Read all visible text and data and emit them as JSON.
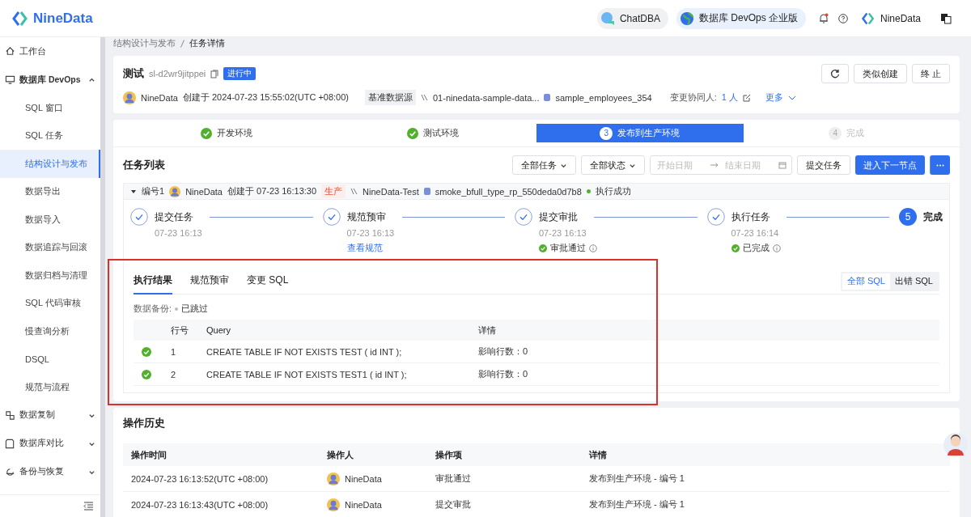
{
  "header": {
    "brand": "NineData",
    "chat_button": "ChatDBA",
    "edition_button": "数据库 DevOps 企业版",
    "user": "NineData"
  },
  "sidebar": {
    "items": [
      {
        "kind": "link",
        "label": "工作台",
        "selected": false
      },
      {
        "kind": "group",
        "label": "数据库 DevOps",
        "expanded": true,
        "children": [
          {
            "label": "SQL 窗口",
            "selected": false
          },
          {
            "label": "SQL 任务",
            "selected": false
          },
          {
            "label": "结构设计与发布",
            "selected": true
          },
          {
            "label": "数据导出",
            "selected": false
          },
          {
            "label": "数据导入",
            "selected": false
          },
          {
            "label": "数据追踪与回滚",
            "selected": false
          },
          {
            "label": "数据归档与清理",
            "selected": false
          },
          {
            "label": "SQL 代码审核",
            "selected": false
          },
          {
            "label": "慢查询分析",
            "selected": false
          },
          {
            "label": "DSQL",
            "selected": false
          },
          {
            "label": "规范与流程",
            "selected": false
          }
        ]
      },
      {
        "kind": "group",
        "label": "数据复制",
        "expanded": false
      },
      {
        "kind": "group",
        "label": "数据库对比",
        "expanded": false
      },
      {
        "kind": "group",
        "label": "备份与恢复",
        "expanded": false
      }
    ]
  },
  "breadcrumb": [
    "结构设计与发布",
    "任务详情"
  ],
  "task": {
    "title": "测试",
    "id": "sl-d2wr9jitppei",
    "status": "进行中",
    "creator": "NineData",
    "created": "创建于 2024-07-23 15:55:02(UTC +08:00)",
    "datasource_label": "基准数据源",
    "datasource": "01-ninedata-sample-data...",
    "database": "sample_employees_354",
    "collaborators_label": "变更协同人:",
    "collaborators": "1 人",
    "more": "更多",
    "buttons": [
      "类似创建",
      "终 止"
    ]
  },
  "stages": [
    {
      "label": "开发环境",
      "completed": true,
      "current": false
    },
    {
      "label": "测试环境",
      "completed": true,
      "current": false
    },
    {
      "number": "3",
      "label": "发布到生产环境",
      "completed": false,
      "current": true
    },
    {
      "number": "4",
      "label": "完成",
      "completed": false,
      "current": false
    }
  ],
  "task_list": {
    "title": "任务列表",
    "filters": [
      "全部任务",
      "全部状态"
    ],
    "date_start_placeholder": "开始日期",
    "date_end_placeholder": "结束日期",
    "submit_button": "提交任务",
    "next_button": "进入下一节点",
    "item": {
      "number": "编号1",
      "creator": "NineData",
      "created": "创建于 07-23 16:13:30",
      "env": "生产",
      "instance": "NineData-Test",
      "database": "smoke_bfull_type_rp_550deda0d7b8",
      "result": "执行成功",
      "expanded": true,
      "steps": [
        {
          "label": "提交任务",
          "time": "07-23 16:13",
          "completed": true
        },
        {
          "label": "规范预审",
          "time": "07-23 16:13",
          "completed": true,
          "link": "查看规范"
        },
        {
          "label": "提交审批",
          "time": "07-23 16:13",
          "completed": true,
          "note": "审批通过"
        },
        {
          "label": "执行任务",
          "time": "07-23 16:14",
          "completed": true,
          "note": "已完成"
        },
        {
          "number": "5",
          "label": "完成",
          "completed": false
        }
      ],
      "tabs": [
        {
          "label": "执行结果",
          "selected": true
        },
        {
          "label": "规范预审",
          "selected": false
        },
        {
          "label": "变更 SQL",
          "selected": false
        }
      ],
      "sql_filter": [
        {
          "label": "全部 SQL",
          "selected": true
        },
        {
          "label": "出错 SQL",
          "selected": false
        }
      ],
      "backup_label": "数据备份:",
      "backup_status": "已跳过",
      "results": {
        "columns": [
          "行号",
          "Query",
          "详情"
        ],
        "rows": [
          {
            "success": true,
            "line": "1",
            "query": "CREATE TABLE IF NOT EXISTS TEST ( id INT );",
            "detail": "影响行数：0"
          },
          {
            "success": true,
            "line": "2",
            "query": "CREATE TABLE IF NOT EXISTS TEST1 ( id INT );",
            "detail": "影响行数：0"
          }
        ]
      }
    }
  },
  "history": {
    "title": "操作历史",
    "columns": [
      "操作时间",
      "操作人",
      "操作项",
      "详情"
    ],
    "rows": [
      {
        "time": "2024-07-23 16:13:52(UTC +08:00)",
        "operator": "NineData",
        "action": "审批通过",
        "detail": "发布到生产环境 - 编号 1"
      },
      {
        "time": "2024-07-23 16:13:43(UTC +08:00)",
        "operator": "NineData",
        "action": "提交审批",
        "detail": "发布到生产环境 - 编号 1"
      }
    ]
  }
}
